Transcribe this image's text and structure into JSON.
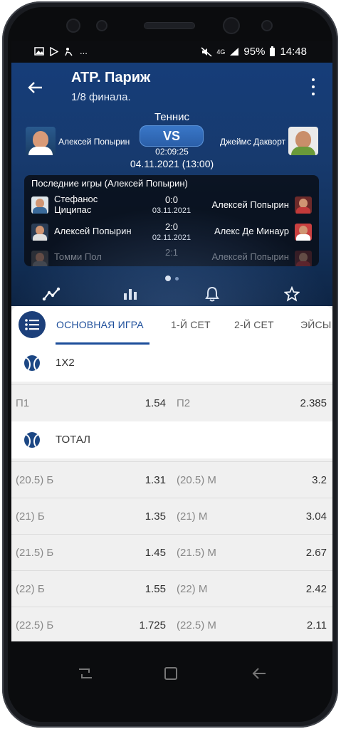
{
  "status_bar": {
    "left_icons": [
      "image-icon",
      "play-store-icon",
      "accessibility-icon",
      "more-dots-icon"
    ],
    "more_text": "...",
    "mute_icon": "mute-icon",
    "network_label": "4G",
    "battery_percent": "95%",
    "time": "14:48"
  },
  "header": {
    "title": "ATP. Париж",
    "subtitle": "1/8 финала.",
    "sport": "Теннис",
    "player1": "Алексей Попырин",
    "player2": "Джеймс Дакворт",
    "vs_label": "VS",
    "timer": "02:09:25",
    "date": "04.11.2021 (13:00)"
  },
  "recent_games": {
    "title": "Последние игры (Алексей Попырин)",
    "rows": [
      {
        "left": "Стефанос\nЦиципас",
        "score": "0:0",
        "date": "03.11.2021",
        "right": "Алексей Попырин"
      },
      {
        "left": "Алексей Попырин",
        "score": "2:0",
        "date": "02.11.2021",
        "right": "Алекс Де Минаур"
      },
      {
        "left": "Томми Пол",
        "score": "2:1",
        "date": "",
        "right": "Алексей Попырин"
      }
    ]
  },
  "carousel": {
    "active_index": 0,
    "count": 2
  },
  "action_icons": [
    "trend-icon",
    "stats-bar-icon",
    "bell-icon",
    "star-icon"
  ],
  "tabs": [
    {
      "label": "ОСНОВНАЯ ИГРА",
      "active": true
    },
    {
      "label": "1-Й СЕТ",
      "active": false
    },
    {
      "label": "2-Й СЕТ",
      "active": false
    },
    {
      "label": "ЭЙСЫ",
      "active": false
    }
  ],
  "markets": {
    "x12": {
      "title": "1X2",
      "rows": [
        {
          "l_label": "П1",
          "l_value": "1.54",
          "r_label": "П2",
          "r_value": "2.385"
        }
      ]
    },
    "total": {
      "title": "ТОТАЛ",
      "rows": [
        {
          "l_label": "(20.5) Б",
          "l_value": "1.31",
          "r_label": "(20.5) М",
          "r_value": "3.2"
        },
        {
          "l_label": "(21) Б",
          "l_value": "1.35",
          "r_label": "(21) М",
          "r_value": "3.04"
        },
        {
          "l_label": "(21.5) Б",
          "l_value": "1.45",
          "r_label": "(21.5) М",
          "r_value": "2.67"
        },
        {
          "l_label": "(22) Б",
          "l_value": "1.55",
          "r_label": "(22) М",
          "r_value": "2.42"
        },
        {
          "l_label": "(22.5) Б",
          "l_value": "1.725",
          "r_label": "(22.5) М",
          "r_value": "2.11"
        }
      ]
    }
  },
  "colors": {
    "brand": "#1c3f7a",
    "accent": "#1c4d9a",
    "header_bg": "#163d79"
  },
  "nav_icons": [
    "recents-icon",
    "home-icon",
    "back-icon"
  ]
}
